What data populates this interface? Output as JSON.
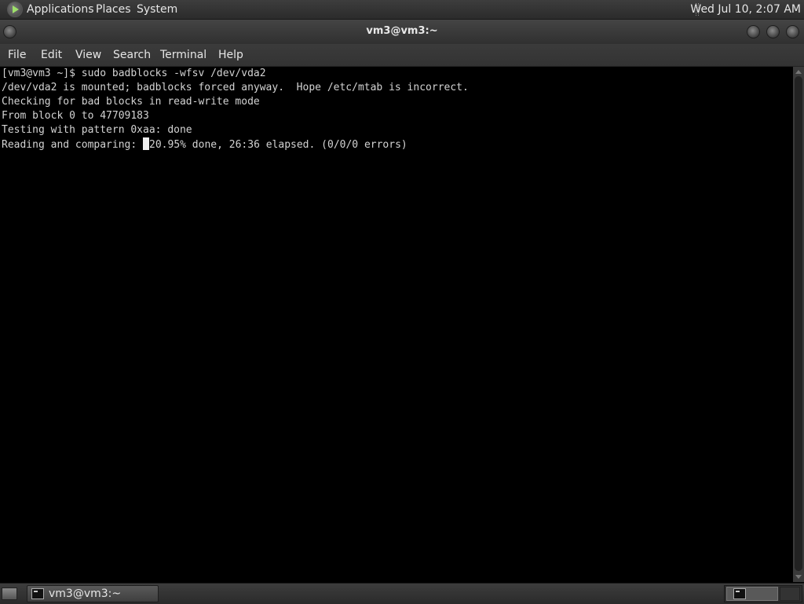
{
  "top_panel": {
    "menus": [
      "Applications",
      "Places",
      "System"
    ],
    "clock": "Wed Jul 10,  2:07 AM"
  },
  "window": {
    "title": "vm3@vm3:~",
    "menu": [
      "File",
      "Edit",
      "View",
      "Search",
      "Terminal",
      "Help"
    ]
  },
  "terminal": {
    "lines": [
      "[vm3@vm3 ~]$ sudo badblocks -wfsv /dev/vda2",
      "/dev/vda2 is mounted; badblocks forced anyway.  Hope /etc/mtab is incorrect.",
      "Checking for bad blocks in read-write mode",
      "From block 0 to 47709183",
      "Testing with pattern 0xaa: done"
    ],
    "progress_prefix": "Reading and comparing: ",
    "progress_suffix": "20.95% done, 26:36 elapsed. (0/0/0 errors)"
  },
  "bottom_panel": {
    "task_label": "vm3@vm3:~"
  },
  "icons": {
    "apps": "applications-icon",
    "terminal": "terminal-icon",
    "desktop": "show-desktop-icon"
  }
}
